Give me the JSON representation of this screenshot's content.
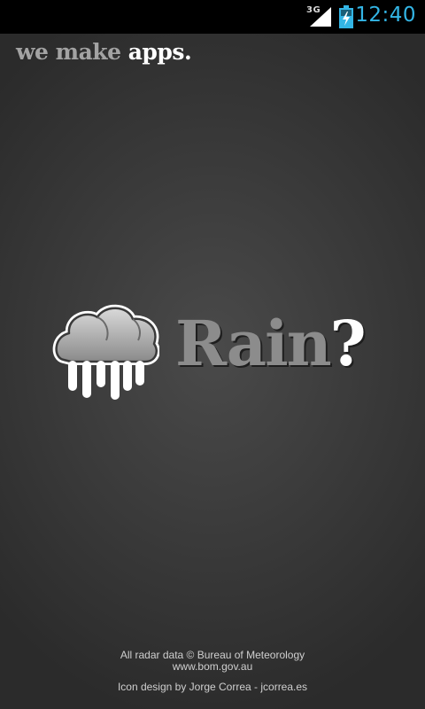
{
  "status_bar": {
    "network_type": "3G",
    "signal_icon": "cellular-signal-icon",
    "battery_icon": "battery-charging-icon",
    "time": "12:40",
    "clock_color": "#33b5e5"
  },
  "header": {
    "tagline_prefix": "we make ",
    "tagline_emphasis": "apps."
  },
  "logo": {
    "icon": "rain-cloud-icon",
    "app_name": "Rain",
    "app_name_suffix": "?"
  },
  "footer": {
    "radar_credit": "All radar data © Bureau of Meteorology",
    "radar_url": "www.bom.gov.au",
    "icon_credit": "Icon design by Jorge Correa - jcorrea.es"
  },
  "colors": {
    "background": "#3a3a3a",
    "accent": "#33b5e5",
    "rain_drops": "#6ec6e6"
  }
}
